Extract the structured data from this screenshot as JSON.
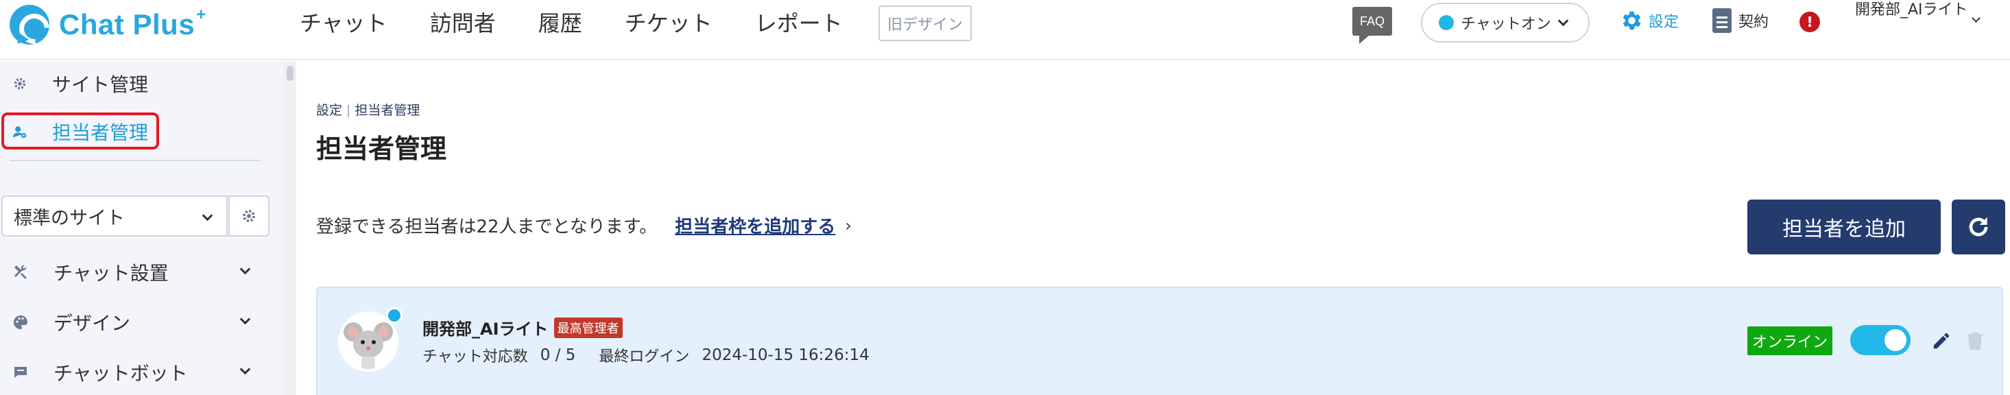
{
  "header": {
    "logo_text": "Chat Plus",
    "logo_plus": "+",
    "nav": [
      "チャット",
      "訪問者",
      "履歴",
      "チケット",
      "レポート"
    ],
    "old_design_label": "旧デザイン",
    "faq_label": "FAQ",
    "chat_status_label": "チャットオン",
    "settings_label": "設定",
    "contract_label": "契約",
    "alert_label": "!",
    "user_name": "開発部_AIライト"
  },
  "sidebar": {
    "site_admin_label": "サイト管理",
    "agent_admin_label": "担当者管理",
    "site_select_value": "標準のサイト",
    "menu": [
      "チャット設置",
      "デザイン",
      "チャットボット"
    ]
  },
  "main": {
    "breadcrumb": [
      "設定",
      "担当者管理"
    ],
    "title": "担当者管理",
    "info_text": "登録できる担当者は22人までとなります。",
    "info_link": "担当者枠を追加する",
    "info_arrow": "›",
    "add_button": "担当者を追加"
  },
  "agent": {
    "name": "開発部_AIライト",
    "role": "最高管理者",
    "chat_count_label": "チャット対応数",
    "chat_count_value": "0 / 5",
    "last_login_label": "最終ログイン",
    "last_login_value": "2024-10-15 16:26:14",
    "status": "オンライン",
    "enabled": true
  },
  "colors": {
    "brand": "#2aa7dd",
    "primary_button": "#243b6e",
    "highlight_box": "#e21b23",
    "online_green": "#10a810",
    "toggle_on": "#22b8e8"
  }
}
